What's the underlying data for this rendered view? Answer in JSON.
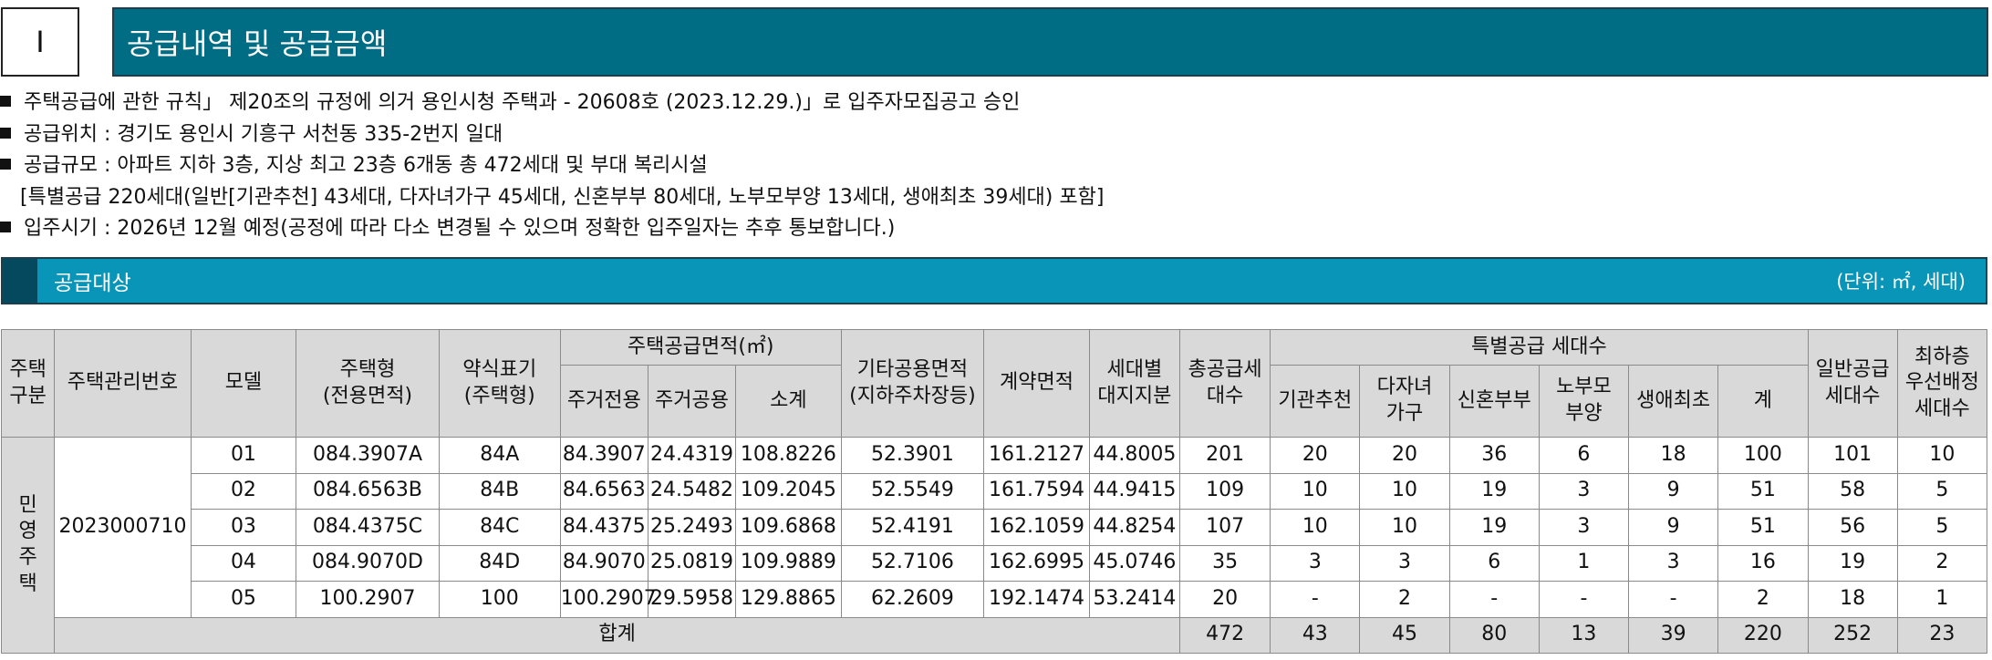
{
  "header": {
    "number": "I",
    "title": "공급내역 및 공급금액"
  },
  "info_lines": [
    "주택공급에 관한 규칙」 제20조의 규정에 의거  용인시청 주택과 -  20608호 (2023.12.29.)」로 입주자모집공고 승인",
    "공급위치 : 경기도 용인시 기흥구 서천동 335-2번지 일대",
    "공급규모 : 아파트 지하 3층, 지상 최고 23층 6개동 총 472세대 및 부대 복리시설",
    "[특별공급 220세대(일반[기관추천] 43세대, 다자녀가구 45세대, 신혼부부 80세대, 노부모부양 13세대, 생애최초 39세대) 포함]",
    "입주시기 : 2026년 12월 예정(공정에 따라 다소 변경될 수 있으며 정확한 입주일자는 추후 통보합니다.)"
  ],
  "section": {
    "title": "공급대상",
    "unit": "(단위: ㎡, 세대)"
  },
  "table": {
    "headers": {
      "type": "주택\n구분",
      "mgmt_no": "주택관리번호",
      "model": "모델",
      "housing_type": "주택형\n(전용면적)",
      "abbr": "약식표기\n(주택형)",
      "supply_area": "주택공급면적(㎡)",
      "private": "주거전용",
      "common": "주거공용",
      "subtotal": "소계",
      "other_common": "기타공용면적\n(지하주차장등)",
      "contract_area": "계약면적",
      "land_share": "세대별\n대지지분",
      "total_units": "총공급세\n대수",
      "special": "특별공급 세대수",
      "institution": "기관추천",
      "multi_child": "다자녀\n가구",
      "newlywed": "신혼부부",
      "elderly": "노부모\n부양",
      "first_time": "생애최초",
      "special_sum": "계",
      "general": "일반공급\n세대수",
      "lowest_floor": "최하층\n우선배정\n세대수"
    },
    "type_value": "민\n영\n주\n택",
    "mgmt_no_value": "2023000710",
    "rows": [
      {
        "model": "01",
        "housing_type": "084.3907A",
        "abbr": "84A",
        "private": "84.3907",
        "common": "24.4319",
        "subtotal": "108.8226",
        "other_common": "52.3901",
        "contract_area": "161.2127",
        "land_share": "44.8005",
        "total_units": "201",
        "institution": "20",
        "multi_child": "20",
        "newlywed": "36",
        "elderly": "6",
        "first_time": "18",
        "special_sum": "100",
        "general": "101",
        "lowest_floor": "10"
      },
      {
        "model": "02",
        "housing_type": "084.6563B",
        "abbr": "84B",
        "private": "84.6563",
        "common": "24.5482",
        "subtotal": "109.2045",
        "other_common": "52.5549",
        "contract_area": "161.7594",
        "land_share": "44.9415",
        "total_units": "109",
        "institution": "10",
        "multi_child": "10",
        "newlywed": "19",
        "elderly": "3",
        "first_time": "9",
        "special_sum": "51",
        "general": "58",
        "lowest_floor": "5"
      },
      {
        "model": "03",
        "housing_type": "084.4375C",
        "abbr": "84C",
        "private": "84.4375",
        "common": "25.2493",
        "subtotal": "109.6868",
        "other_common": "52.4191",
        "contract_area": "162.1059",
        "land_share": "44.8254",
        "total_units": "107",
        "institution": "10",
        "multi_child": "10",
        "newlywed": "19",
        "elderly": "3",
        "first_time": "9",
        "special_sum": "51",
        "general": "56",
        "lowest_floor": "5"
      },
      {
        "model": "04",
        "housing_type": "084.9070D",
        "abbr": "84D",
        "private": "84.9070",
        "common": "25.0819",
        "subtotal": "109.9889",
        "other_common": "52.7106",
        "contract_area": "162.6995",
        "land_share": "45.0746",
        "total_units": "35",
        "institution": "3",
        "multi_child": "3",
        "newlywed": "6",
        "elderly": "1",
        "first_time": "3",
        "special_sum": "16",
        "general": "19",
        "lowest_floor": "2"
      },
      {
        "model": "05",
        "housing_type": "100.2907",
        "abbr": "100",
        "private": "100.2907",
        "common": "29.5958",
        "subtotal": "129.8865",
        "other_common": "62.2609",
        "contract_area": "192.1474",
        "land_share": "53.2414",
        "total_units": "20",
        "institution": "-",
        "multi_child": "2",
        "newlywed": "-",
        "elderly": "-",
        "first_time": "-",
        "special_sum": "2",
        "general": "18",
        "lowest_floor": "1"
      }
    ],
    "total": {
      "label": "합계",
      "total_units": "472",
      "institution": "43",
      "multi_child": "45",
      "newlywed": "80",
      "elderly": "13",
      "first_time": "39",
      "special_sum": "220",
      "general": "252",
      "lowest_floor": "23"
    }
  }
}
